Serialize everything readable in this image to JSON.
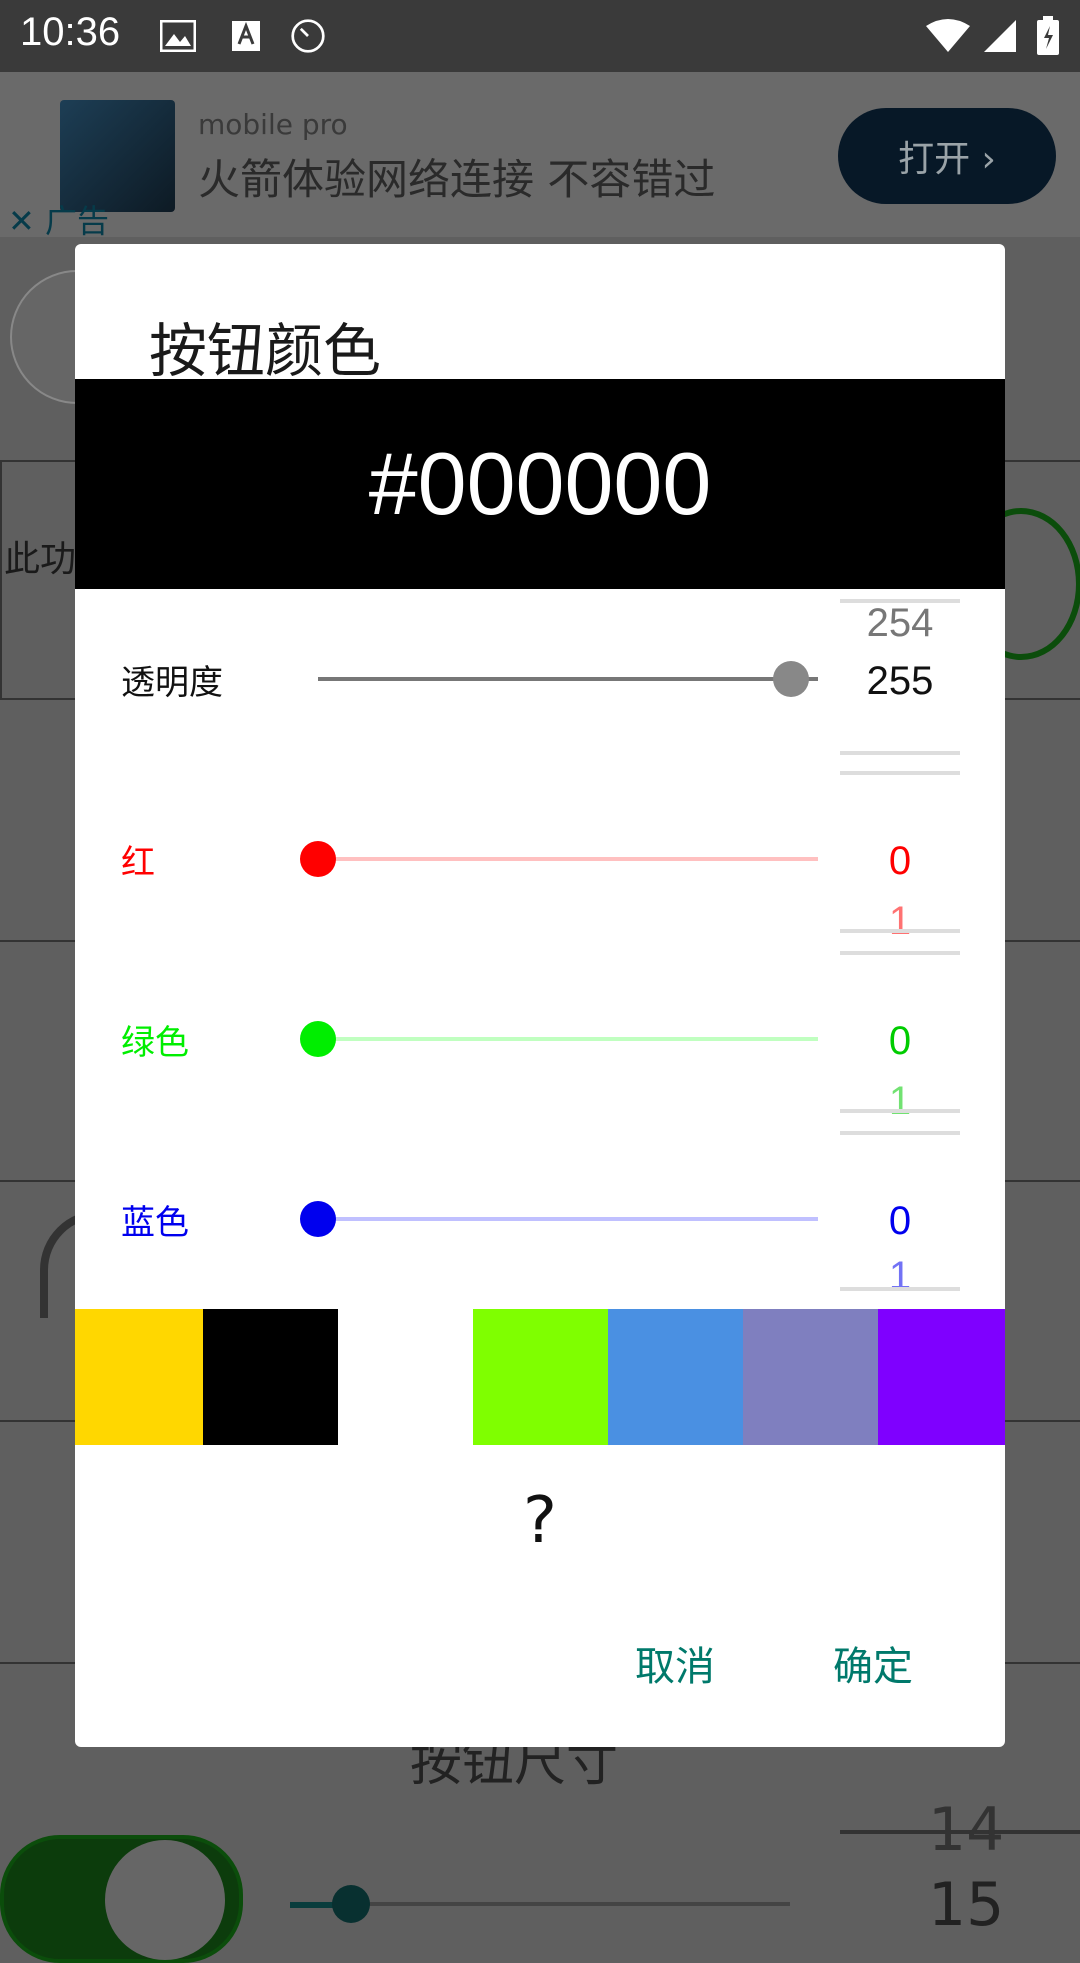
{
  "status_bar": {
    "time": "10:36"
  },
  "background": {
    "ad": {
      "brand": "mobile pro",
      "title": "火箭体验网络连接 不容错过",
      "open_label": "打开 ›",
      "close_label": "✕ 广告"
    },
    "side_text": "此功",
    "partial_text": "按钮尺寸",
    "picker_prev": "14",
    "picker_current": "15"
  },
  "dialog": {
    "title": "按钮颜色",
    "hex": "#000000",
    "rows": [
      {
        "label": "透明度",
        "color": "#000000",
        "value": 255,
        "prev": "254",
        "next": ""
      },
      {
        "label": "红",
        "color": "#ff0000",
        "value": 0,
        "prev": "",
        "next": "1"
      },
      {
        "label": "绿色",
        "color": "#00ee00",
        "value": 0,
        "prev": "",
        "next": "1"
      },
      {
        "label": "蓝色",
        "color": "#0000ee",
        "value": 0,
        "prev": "",
        "next": "1"
      }
    ],
    "swatches": [
      "#FFD700",
      "#000000",
      "#FFFFFF",
      "#7FFF00",
      "#4A90E2",
      "#7F7FBF",
      "#7F00FF"
    ],
    "question": "?",
    "cancel_label": "取消",
    "ok_label": "确定"
  }
}
